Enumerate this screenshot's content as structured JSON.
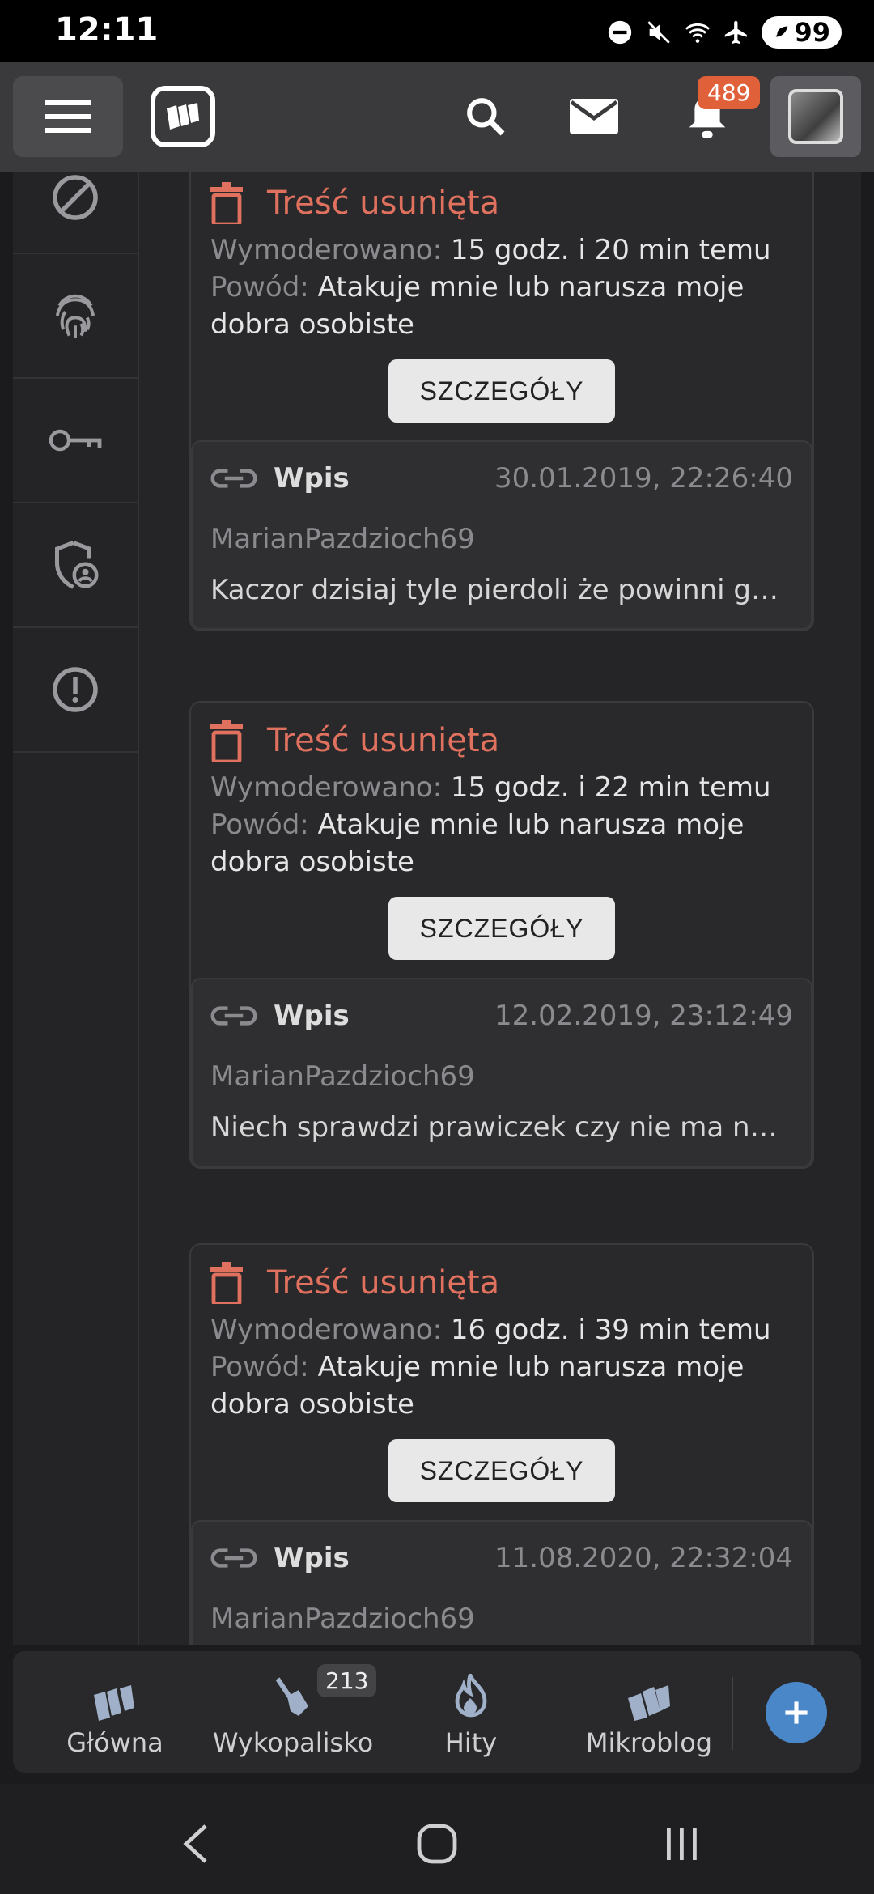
{
  "status_bar": {
    "time": "12:11",
    "battery": "99"
  },
  "appbar": {
    "notifications_count": "489"
  },
  "cards": [
    {
      "title": "Treść usunięta",
      "moderated_label": "Wymoderowano:",
      "moderated_value": "15 godz. i 20 min temu",
      "reason_label": "Powód:",
      "reason_value": "Atakuje mnie lub narusza moje dobra osobiste",
      "button": "SZCZEGÓŁY",
      "entry_type": "Wpis",
      "entry_date": "30.01.2019, 22:26:40",
      "entry_user": "MarianPazdzioch69",
      "entry_text": "Kaczor dzisiaj tyle pierdoli że powinni go wzi…"
    },
    {
      "title": "Treść usunięta",
      "moderated_label": "Wymoderowano:",
      "moderated_value": "15 godz. i 22 min temu",
      "reason_label": "Powód:",
      "reason_value": "Atakuje mnie lub narusza moje dobra osobiste",
      "button": "SZCZEGÓŁY",
      "entry_type": "Wpis",
      "entry_date": "12.02.2019, 23:12:49",
      "entry_user": "MarianPazdzioch69",
      "entry_text": "Niech sprawdzi prawiczek czy nie ma nalane…"
    },
    {
      "title": "Treść usunięta",
      "moderated_label": "Wymoderowano:",
      "moderated_value": "16 godz. i 39 min temu",
      "reason_label": "Powód:",
      "reason_value": "Atakuje mnie lub narusza moje dobra osobiste",
      "button": "SZCZEGÓŁY",
      "entry_type": "Wpis",
      "entry_date": "11.08.2020, 22:32:04",
      "entry_user": "MarianPazdzioch69",
      "entry_text": ""
    }
  ],
  "bottom_nav": {
    "items": [
      {
        "label": "Główna"
      },
      {
        "label": "Wykopalisko",
        "badge": "213"
      },
      {
        "label": "Hity"
      },
      {
        "label": "Mikroblog"
      }
    ]
  },
  "colors": {
    "accent_red": "#e0715e",
    "badge_orange": "#e0603a",
    "fab_blue": "#4a87c8"
  }
}
